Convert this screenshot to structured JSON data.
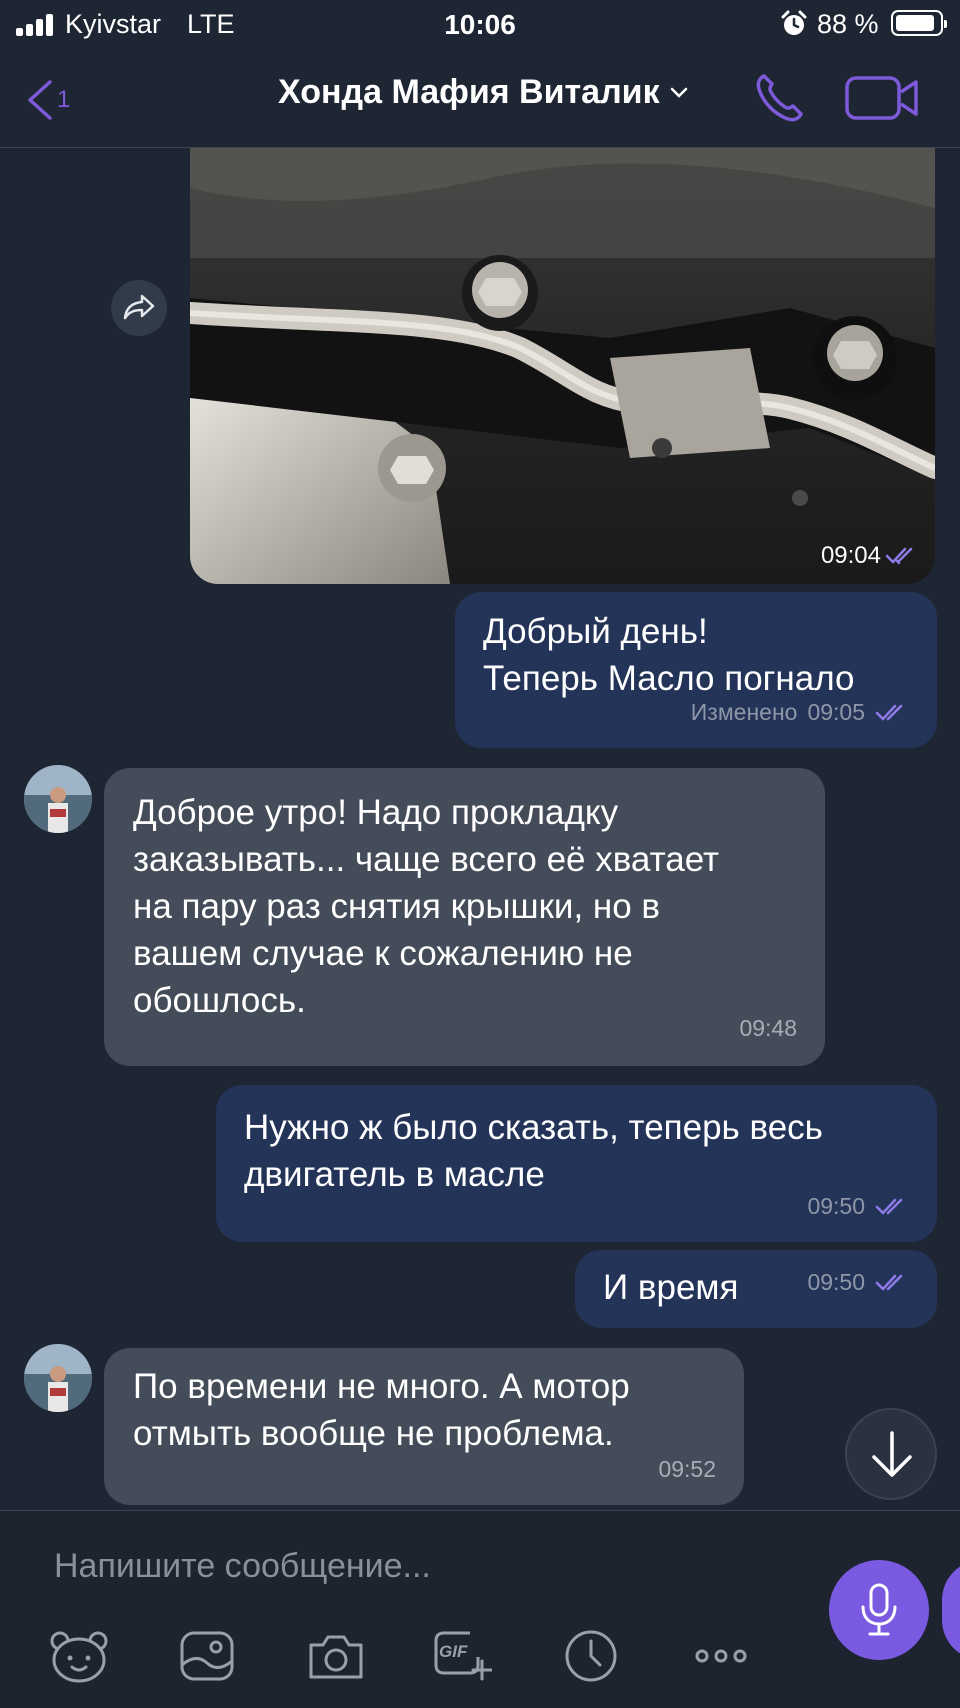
{
  "status_bar": {
    "carrier": "Kyivstar",
    "network": "LTE",
    "time": "10:06",
    "battery": "88 %"
  },
  "header": {
    "back_count": "1",
    "title": "Хонда Мафия Виталик"
  },
  "messages": [
    {
      "type": "photo",
      "direction": "outgoing",
      "time": "09:04"
    },
    {
      "direction": "outgoing",
      "lines": [
        "Добрый день!",
        "Теперь Масло погнало"
      ],
      "edited": "Изменено",
      "time": "09:05"
    },
    {
      "direction": "incoming",
      "lines": [
        "Доброе утро! Надо прокладку",
        "заказывать... чаще всего её хватает",
        "на пару раз снятия крышки, но в",
        "вашем случае к сожалению не",
        "обошлось."
      ],
      "time": "09:48"
    },
    {
      "direction": "outgoing",
      "lines": [
        "Нужно ж было сказать, теперь весь",
        "двигатель в масле"
      ],
      "time": "09:50"
    },
    {
      "direction": "outgoing",
      "lines": [
        "И время"
      ],
      "time": "09:50"
    },
    {
      "direction": "incoming",
      "lines": [
        "По времени не много. А мотор",
        "отмыть вообще не проблема."
      ],
      "time": "09:52"
    }
  ],
  "composer": {
    "placeholder": "Напишите сообщение...",
    "gif_label": "GIF"
  },
  "colors": {
    "background": "#1f2633",
    "outgoing_bubble": "#243459",
    "incoming_bubble": "#454c59",
    "accent": "#7a5ae0"
  }
}
